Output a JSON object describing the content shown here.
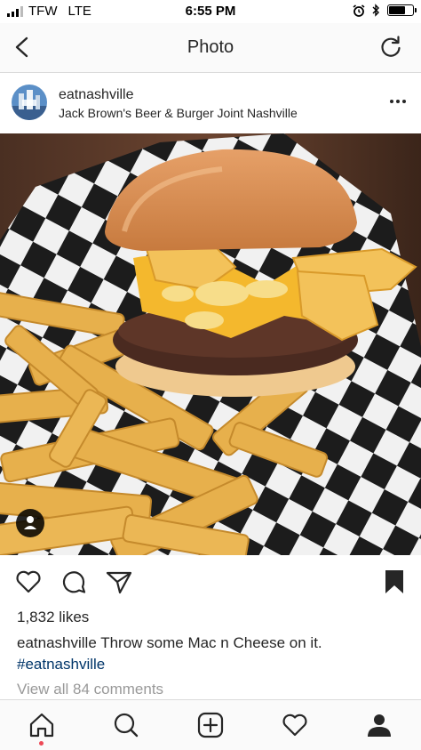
{
  "status": {
    "carrier": "TFW",
    "network": "LTE",
    "time": "6:55 PM"
  },
  "nav": {
    "title": "Photo",
    "back_icon": "chevron-left-icon",
    "refresh_icon": "refresh-icon"
  },
  "post": {
    "username": "eatnashville",
    "location": "Jack Brown's Beer & Burger Joint Nashville",
    "likes": "1,832 likes",
    "caption_user": "eatnashville",
    "caption_text": " Throw some Mac n Cheese on it.",
    "hashtag": "#eatnashville",
    "comments_link": "View all 84 comments"
  },
  "colors": {
    "hashtag": "#003569",
    "muted": "#999999",
    "notification_dot": "#ed4956"
  },
  "tabs": [
    {
      "name": "home",
      "icon": "home-icon"
    },
    {
      "name": "search",
      "icon": "search-icon"
    },
    {
      "name": "new-post",
      "icon": "plus-square-icon"
    },
    {
      "name": "activity",
      "icon": "heart-icon"
    },
    {
      "name": "profile",
      "icon": "person-icon"
    }
  ]
}
